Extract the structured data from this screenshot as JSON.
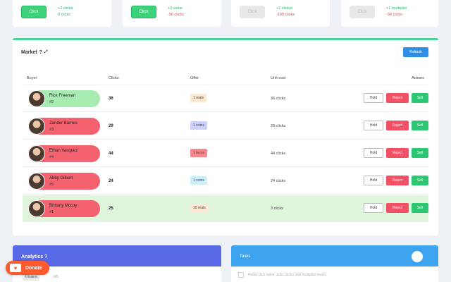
{
  "top_cards": [
    {
      "button": "Click",
      "enabled": true,
      "line1": "+2 clicks",
      "line2": "0 clicks",
      "line2_color": "green"
    },
    {
      "button": "Click",
      "enabled": true,
      "line1": "+3 value",
      "line2": "-56 clicks",
      "line2_color": "red"
    },
    {
      "button": "Click",
      "enabled": false,
      "line1": "+1 clicker",
      "line2": "-100 clicks",
      "line2_color": "red"
    },
    {
      "button": "Click",
      "enabled": false,
      "line1": "+1 multiplier",
      "line2": "-39 clicks",
      "line2_color": "red"
    }
  ],
  "market": {
    "title": "Market",
    "help": "?",
    "expand_icon": "⤢",
    "refresh_label": "Refresh",
    "headers": {
      "buyer": "Buyer",
      "clicks": "Clicks",
      "offer": "Offer",
      "unit_cost": "Unit cost",
      "actions": "Actions"
    },
    "actions": {
      "hold": "Hold",
      "reject": "Reject",
      "sell": "Sell"
    },
    "rows": [
      {
        "name": "Rick Freeman",
        "id": "#2",
        "pill": "green",
        "clicks": "36",
        "offer": "1 reals",
        "offer_color": "peach",
        "unit": "36 clicks",
        "highlight": false
      },
      {
        "name": "Zander Barnes",
        "id": "#3",
        "pill": "red",
        "clicks": "29",
        "offer": "1 coins",
        "offer_color": "lav",
        "unit": "29 clicks",
        "highlight": false
      },
      {
        "name": "Ethan Vasquez",
        "id": "#4",
        "pill": "red",
        "clicks": "44",
        "offer": "1 tacos",
        "offer_color": "pink",
        "unit": "44 clicks",
        "highlight": false
      },
      {
        "name": "Abby Gilbert",
        "id": "#5",
        "pill": "red",
        "clicks": "24",
        "offer": "1 coins",
        "offer_color": "cyan",
        "unit": "24 clicks",
        "highlight": false
      },
      {
        "name": "Brittany Mccoy",
        "id": "#1",
        "pill": "red",
        "clicks": "25",
        "offer": "10 reals",
        "offer_color": "peach",
        "unit": "3 clicks",
        "highlight": true
      }
    ]
  },
  "analytics": {
    "title": "Analytics",
    "help": "?",
    "badge": "0 trains",
    "sub": "0/5"
  },
  "tasks": {
    "title": "Tasks",
    "item": "Reset click value, auto clicker and multiplier levels"
  },
  "donate": {
    "label": "Donate",
    "icon": "coffee-cup-icon"
  },
  "colors": {
    "green": "#3ed27a",
    "red": "#f25064",
    "blue": "#2f8fe6",
    "analytics": "#5869e8",
    "tasks": "#3ea3ee",
    "donate": "#ff5a2e"
  }
}
